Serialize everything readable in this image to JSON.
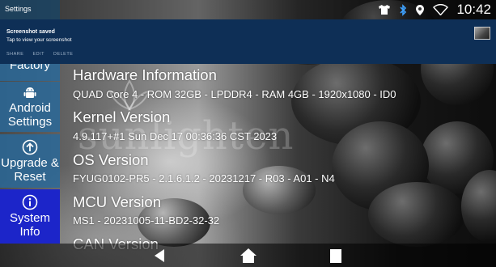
{
  "status_bar": {
    "title": "Settings",
    "time": "10:42",
    "icons": [
      "tshirt-icon",
      "bluetooth-icon",
      "location-icon",
      "wifi-icon"
    ]
  },
  "notification": {
    "title": "Screenshot saved",
    "subtitle": "Tap to view your screenshot",
    "actions": [
      "SHARE",
      "EDIT",
      "DELETE"
    ]
  },
  "sidebar": {
    "items": [
      {
        "label": "Factory",
        "icon": "factory-icon",
        "active": false
      },
      {
        "label": "Android Settings",
        "icon": "android-icon",
        "active": false
      },
      {
        "label": "Upgrade & Reset",
        "icon": "upgrade-arrow-icon",
        "active": false
      },
      {
        "label": "System Info",
        "icon": "info-icon",
        "active": true
      }
    ]
  },
  "main": {
    "sections": [
      {
        "heading": "Hardware Information",
        "value": "QUAD Core 4 - ROM 32GB - LPDDR4 - RAM 4GB - 1920x1080  - ID0"
      },
      {
        "heading": "Kernel Version",
        "value": "4.9.117+#1 Sun Dec 17 00:36:36 CST 2023"
      },
      {
        "heading": "OS Version",
        "value": "FYUG0102-PR5 - 2.1.6.1.2 - 20231217 - R03 - A01 - N4"
      },
      {
        "heading": "MCU Version",
        "value": "MS1 - 20231005-11-BD2-32-32"
      },
      {
        "heading": "CAN Version",
        "value": ""
      }
    ]
  },
  "background": {
    "watermark": "sunlighten"
  },
  "navbar": {
    "buttons": [
      "back-icon",
      "home-icon",
      "recents-icon"
    ]
  },
  "colors": {
    "notification_bg": "#0e2f56",
    "sidebar_bg": "#28699b",
    "sidebar_active": "#1c25c9"
  }
}
